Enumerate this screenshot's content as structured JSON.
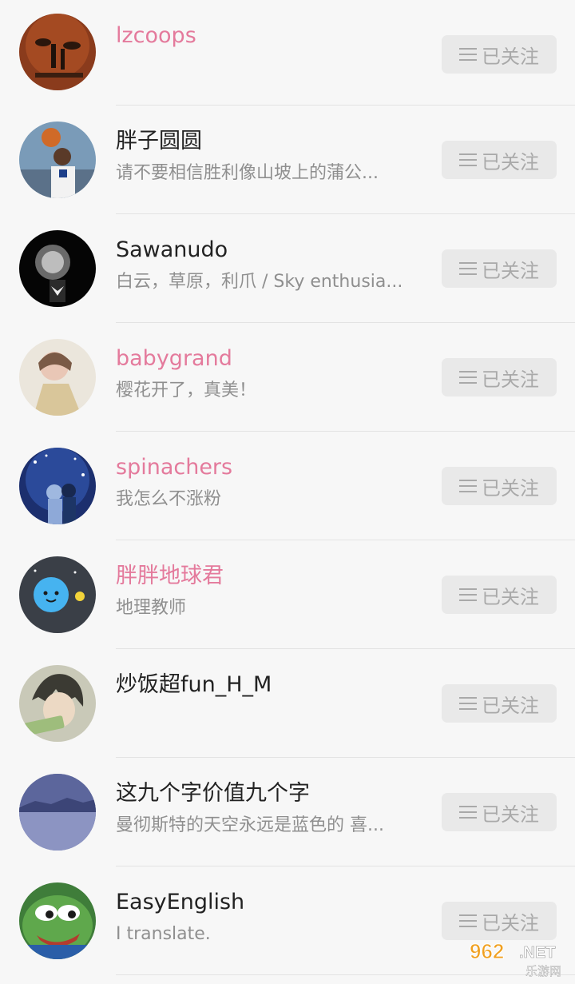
{
  "follow_label": "已关注",
  "watermark_text": "962.NET 乐游网",
  "users": [
    {
      "name": "lzcoops",
      "bio": "",
      "name_color": "pink"
    },
    {
      "name": "胖子圆圆",
      "bio": "请不要相信胜利像山坡上的蒲公...",
      "name_color": "default"
    },
    {
      "name": "Sawanudo",
      "bio": "白云，草原，利爪 / Sky enthusia...",
      "name_color": "default"
    },
    {
      "name": "babygrand",
      "bio": "樱花开了，真美！",
      "name_color": "pink"
    },
    {
      "name": "spinachers",
      "bio": "我怎么不涨粉",
      "name_color": "pink"
    },
    {
      "name": "胖胖地球君",
      "bio": "地理教师",
      "name_color": "pink"
    },
    {
      "name": "炒饭超fun_H_M",
      "bio": "",
      "name_color": "default"
    },
    {
      "name": "这九个字价值九个字",
      "bio": "曼彻斯特的天空永远是蓝色的 喜...",
      "name_color": "default"
    },
    {
      "name": "EasyEnglish",
      "bio": "I translate.",
      "name_color": "default"
    }
  ],
  "colors": {
    "pink_name": "#e47a9c",
    "default_name": "#222222",
    "bio": "#8f8f8f",
    "button_bg": "#e9e9e9",
    "button_text": "#a9a9a9"
  }
}
